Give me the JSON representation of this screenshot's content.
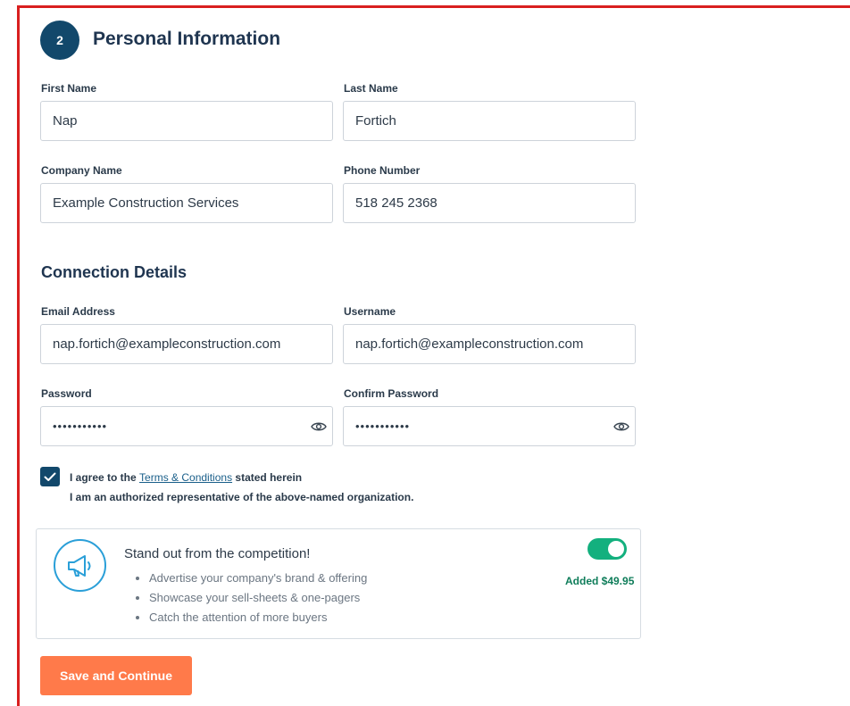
{
  "step": {
    "number": "2",
    "title": "Personal Information"
  },
  "personal": {
    "first_name": {
      "label": "First Name",
      "value": "Nap"
    },
    "last_name": {
      "label": "Last Name",
      "value": "Fortich"
    },
    "company": {
      "label": "Company Name",
      "value": "Example Construction Services"
    },
    "phone": {
      "label": "Phone Number",
      "value": "518 245 2368"
    }
  },
  "connection": {
    "title": "Connection Details",
    "email": {
      "label": "Email Address",
      "value": "nap.fortich@exampleconstruction.com"
    },
    "username": {
      "label": "Username",
      "value": "nap.fortich@exampleconstruction.com"
    },
    "password": {
      "label": "Password",
      "value": "•••••••••••"
    },
    "confirm_password": {
      "label": "Confirm Password",
      "value": "•••••••••••"
    }
  },
  "agreement": {
    "checked": true,
    "prefix": "I agree to the ",
    "link": "Terms & Conditions",
    "suffix": " stated herein",
    "line2": "I am an authorized representative of the above-named organization."
  },
  "promo": {
    "icon": "megaphone-icon",
    "title": "Stand out from the competition!",
    "items": [
      "Advertise your company's brand & offering",
      "Showcase your sell-sheets & one-pagers",
      "Catch the attention of more buyers"
    ],
    "toggle_on": true,
    "added_label": "Added $49.95"
  },
  "actions": {
    "save_label": "Save and Continue"
  },
  "colors": {
    "frame_border": "#d91f1f",
    "primary": "#12486b",
    "toggle": "#13b07e",
    "added_text": "#0f7d5a",
    "cta": "#ff7a4a",
    "icon_blue": "#2a9fd8"
  }
}
